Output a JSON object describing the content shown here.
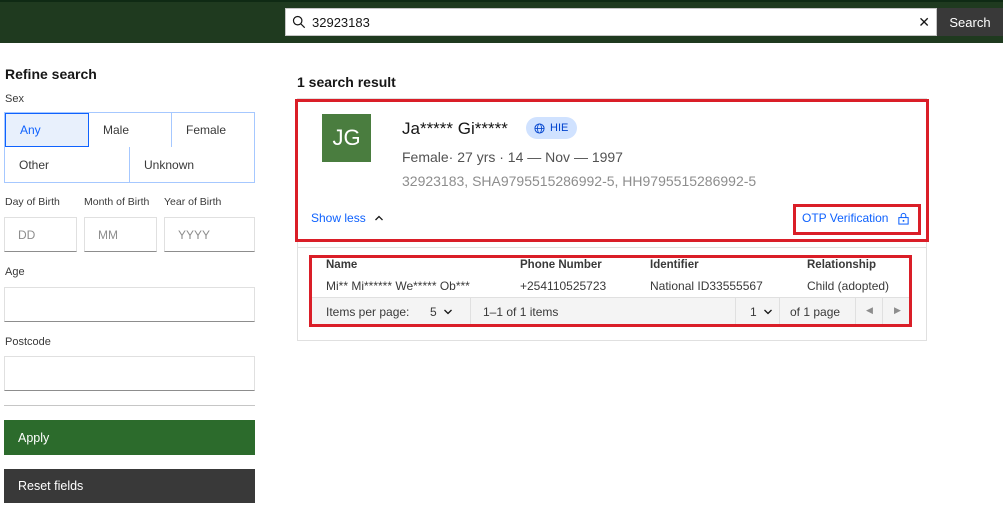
{
  "header": {
    "search_value": "32923183",
    "search_button": "Search",
    "clear_icon": "close-icon"
  },
  "sidebar": {
    "title": "Refine search",
    "sex_label": "Sex",
    "sex_options": [
      "Any",
      "Male",
      "Female",
      "Other",
      "Unknown"
    ],
    "sex_selected": "Any",
    "day_label": "Day of Birth",
    "month_label": "Month of Birth",
    "year_label": "Year of Birth",
    "day_placeholder": "DD",
    "month_placeholder": "MM",
    "year_placeholder": "YYYY",
    "age_label": "Age",
    "postcode_label": "Postcode",
    "apply_label": "Apply",
    "reset_label": "Reset fields"
  },
  "results": {
    "title": "1 search result",
    "patient": {
      "initials": "JG",
      "name": "Ja***** Gi*****",
      "badge": "HIE",
      "details": "Female· 27 yrs · 14 — Nov — 1997",
      "identifiers": "32923183, SHA9795515286992-5, HH9795515286992-5",
      "show_less": "Show less",
      "otp_label": "OTP Verification"
    },
    "table": {
      "headers": [
        "Name",
        "Phone Number",
        "Identifier",
        "Relationship"
      ],
      "rows": [
        [
          "Mi** Mi****** We***** Ob***",
          "+254110525723",
          "National ID33555567",
          "Child (adopted)"
        ]
      ],
      "items_per_page_label": "Items per page:",
      "items_per_page_value": "5",
      "range_text": "1–1 of 1 items",
      "page_value": "1",
      "page_total": "of 1 page"
    }
  },
  "colors": {
    "topbar": "#1f3a1f",
    "apply": "#2c6b2c",
    "accent": "#0f62fe",
    "highlight": "#da1e28"
  }
}
